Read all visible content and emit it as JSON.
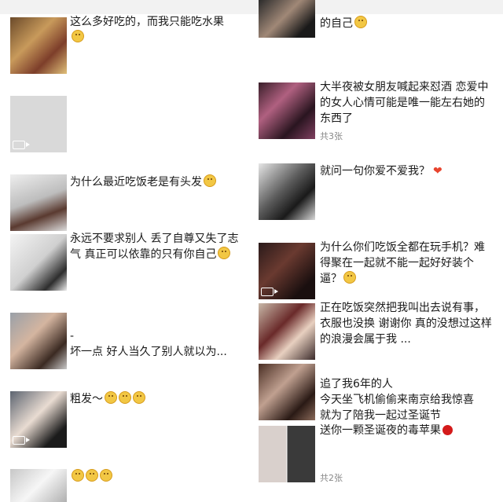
{
  "left_posts": [
    {
      "text": "这么多好吃的，而我只能吃水果"
    },
    {
      "text": ""
    },
    {
      "text": "为什么最近吃饭老是有头发"
    },
    {
      "text": "永远不要求别人 丢了自尊又失了志气 真正可以依靠的只有你自己"
    },
    {
      "text": "-\n坏一点 好人当久了别人就以为..."
    },
    {
      "text": "粗发～"
    },
    {
      "text": ""
    }
  ],
  "right_posts": [
    {
      "text": "的自己"
    },
    {
      "text": "大半夜被女朋友喊起来怼酒 恋爱中的女人心情可能是唯一能左右她的东西了",
      "count": "共3张"
    },
    {
      "text": "就问一句你爱不爱我？"
    },
    {
      "text": "为什么你们吃饭全都在玩手机？难得聚在一起就不能一起好好装个逼？"
    },
    {
      "text": "正在吃饭突然把我叫出去说有事，衣服也没换 谢谢你 真的没想过这样的浪漫会属于我 ..."
    },
    {
      "text": "追了我6年的人\n今天坐飞机偷偷来南京给我惊喜\n就为了陪我一起过圣诞节"
    },
    {
      "text": "送你一颗圣诞夜的毒苹果",
      "count": "共2张"
    }
  ],
  "colors": {
    "accent_heart": "#e8442e",
    "apple": "#d41a1a",
    "muted": "#888888"
  }
}
